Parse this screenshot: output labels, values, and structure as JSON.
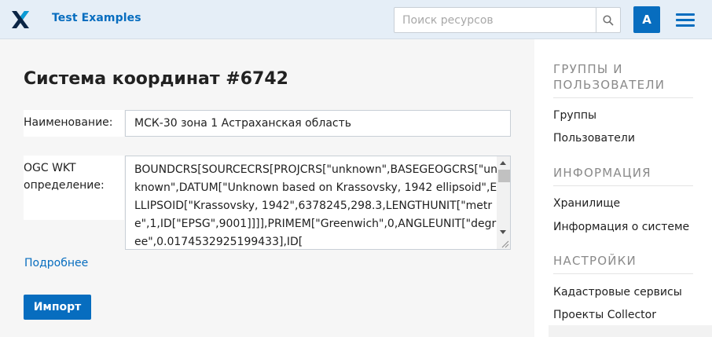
{
  "header": {
    "app_title": "Test Examples",
    "search": {
      "placeholder": "Поиск ресурсов",
      "value": ""
    },
    "avatar_letter": "A",
    "accent_color": "#076dbf"
  },
  "main": {
    "page_title": "Система координат #6742",
    "fields": {
      "name_label": "Наименование:",
      "name_value": "МСК-30 зона 1 Астраханская область",
      "wkt_label_line1": "OGC WKT",
      "wkt_label_line2": "определение:",
      "wkt_value": "BOUNDCRS[SOURCECRS[PROJCRS[\"unknown\",BASEGEOGCRS[\"unknown\",DATUM[\"Unknown based on Krassovsky, 1942 ellipsoid\",ELLIPSOID[\"Krassovsky, 1942\",6378245,298.3,LENGTHUNIT[\"metre\",1,ID[\"EPSG\",9001]]]],PRIMEM[\"Greenwich\",0,ANGLEUNIT[\"degree\",0.0174532925199433],ID["
    },
    "more_link": "Подробнее",
    "import_button": "Импорт"
  },
  "sidebar": {
    "sections": [
      {
        "heading_line1": "ГРУППЫ И",
        "heading_line2": "ПОЛЬЗОВАТЕЛИ",
        "items": [
          "Группы",
          "Пользователи"
        ]
      },
      {
        "heading_line1": "ИНФОРМАЦИЯ",
        "items": [
          "Хранилище",
          "Информация о системе"
        ]
      },
      {
        "heading_line1": "НАСТРОЙКИ",
        "items": [
          "Кадастровые сервисы",
          "Проекты Collector"
        ]
      }
    ]
  }
}
